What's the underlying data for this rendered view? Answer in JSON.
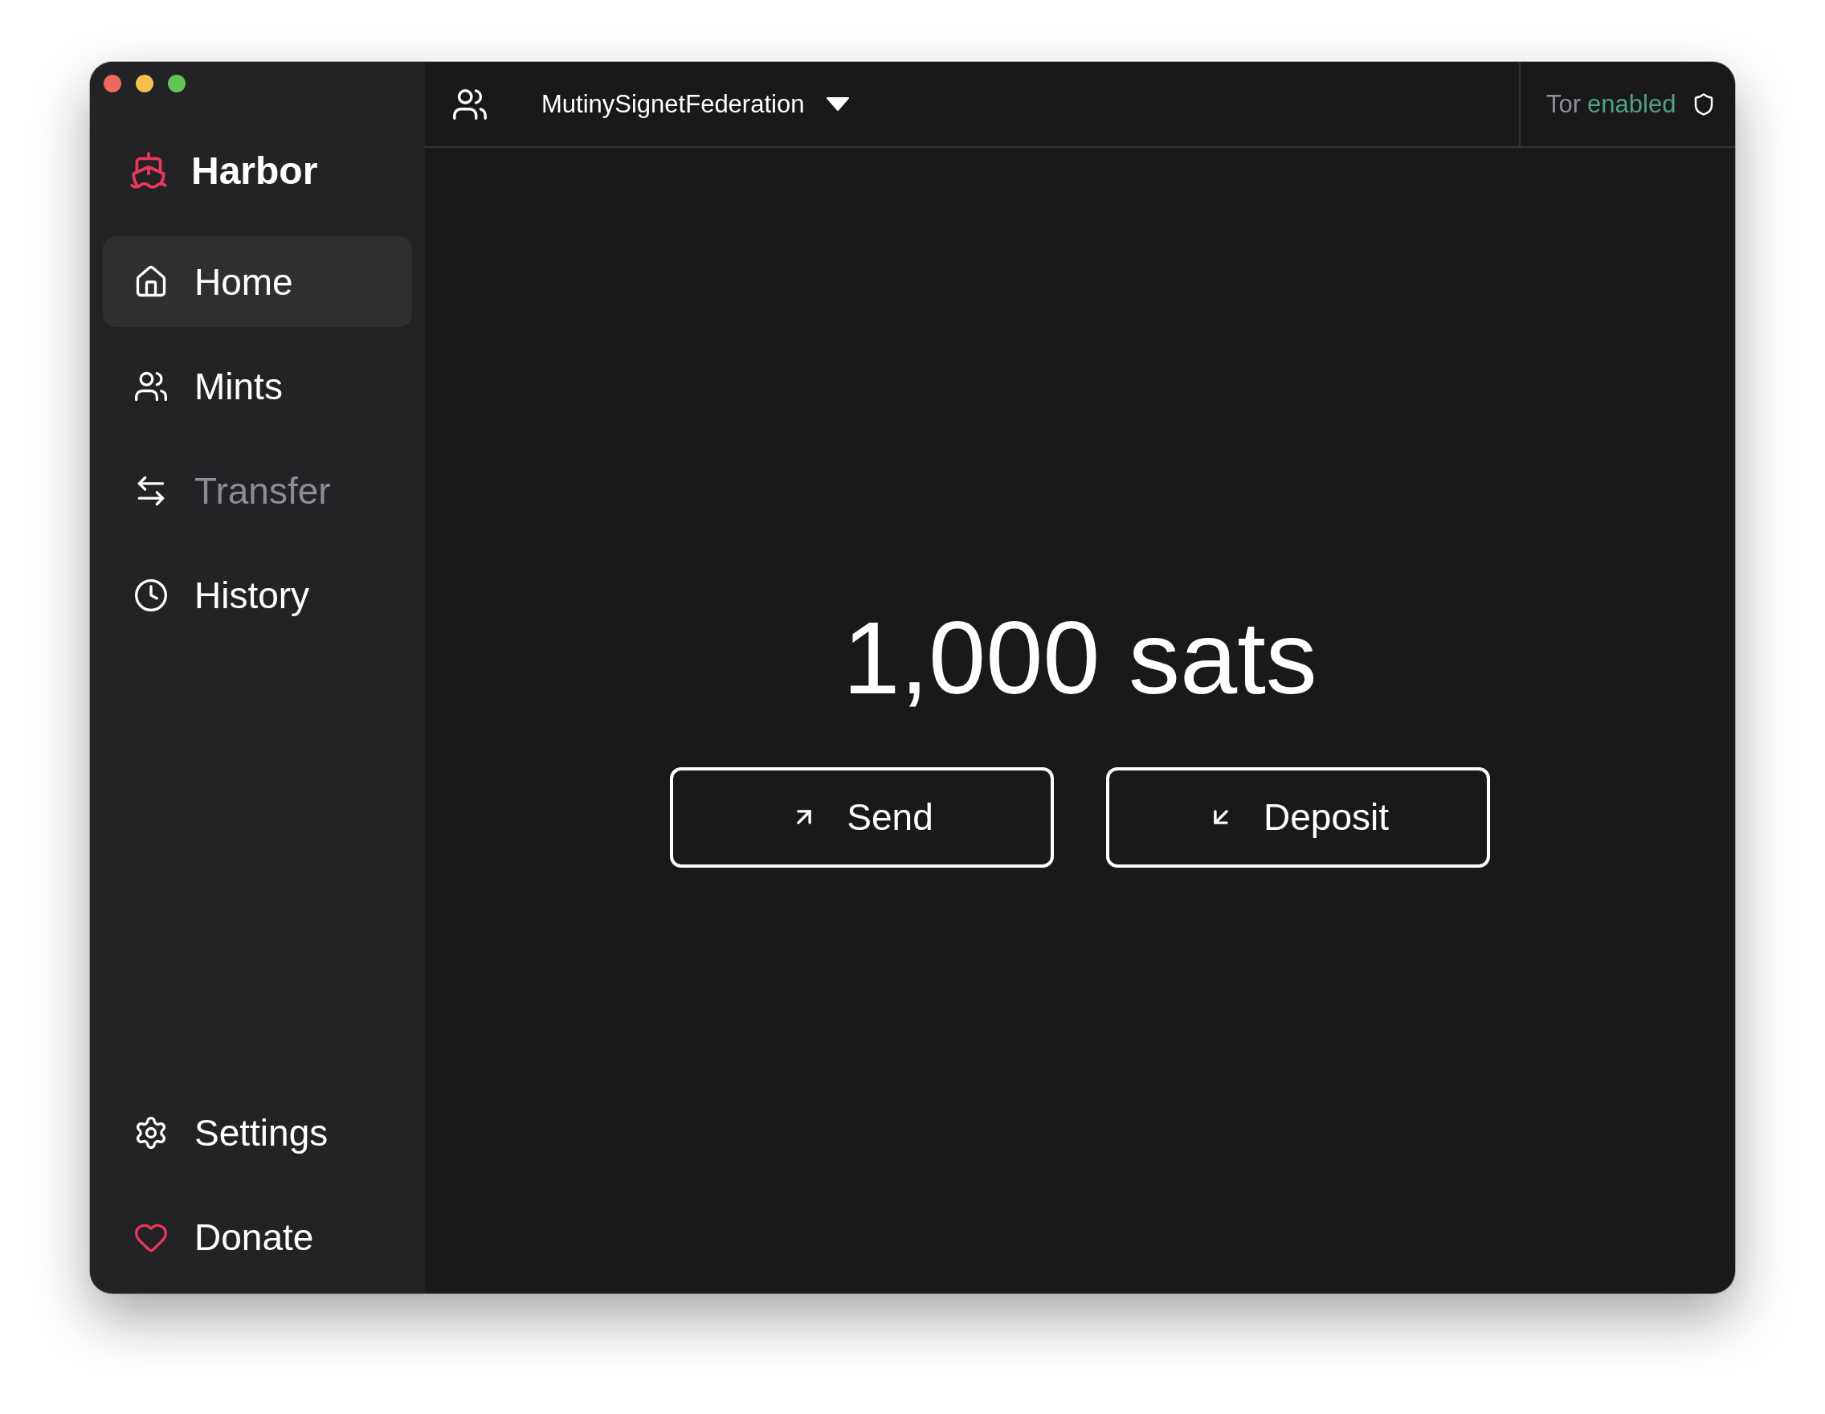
{
  "app": {
    "name": "Harbor"
  },
  "sidebar": {
    "items": [
      {
        "label": "Home",
        "selected": true,
        "disabled": false
      },
      {
        "label": "Mints",
        "selected": false,
        "disabled": false
      },
      {
        "label": "Transfer",
        "selected": false,
        "disabled": true
      },
      {
        "label": "History",
        "selected": false,
        "disabled": false
      }
    ],
    "footer_items": [
      {
        "label": "Settings",
        "selected": false
      },
      {
        "label": "Donate",
        "selected": false
      }
    ]
  },
  "header": {
    "federation": "MutinySignetFederation",
    "tor": {
      "label": "Tor",
      "status": "enabled",
      "on": true
    }
  },
  "balance": "1,000 sats",
  "actions": [
    {
      "label": "Send"
    },
    {
      "label": "Deposit"
    }
  ]
}
